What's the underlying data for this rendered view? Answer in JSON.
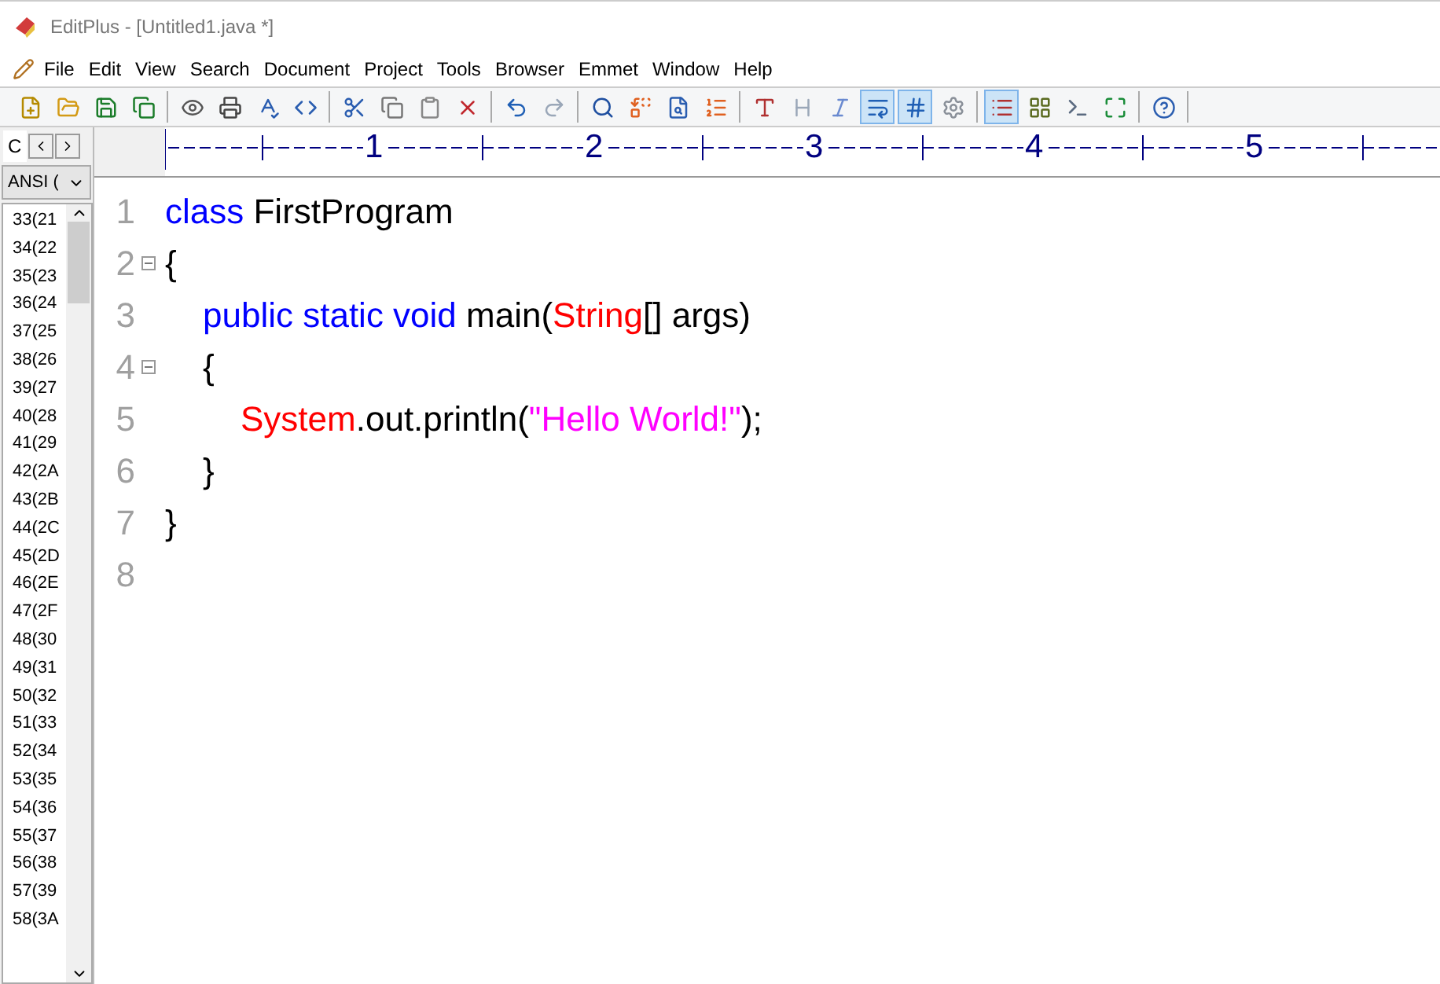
{
  "window": {
    "title": "EditPlus - [Untitled1.java *]"
  },
  "menu": [
    "File",
    "Edit",
    "View",
    "Search",
    "Document",
    "Project",
    "Tools",
    "Browser",
    "Emmet",
    "Window",
    "Help"
  ],
  "toolbar": [
    [
      {
        "kind": "new",
        "selected": false
      },
      {
        "kind": "open",
        "selected": false
      },
      {
        "kind": "save",
        "selected": false
      },
      {
        "kind": "save-all",
        "selected": false
      }
    ],
    [
      {
        "kind": "preview",
        "selected": false
      },
      {
        "kind": "print",
        "selected": false
      },
      {
        "kind": "spell",
        "selected": false
      },
      {
        "kind": "browser",
        "selected": false
      }
    ],
    [
      {
        "kind": "cut",
        "selected": false
      },
      {
        "kind": "copy",
        "selected": false
      },
      {
        "kind": "paste",
        "selected": false
      },
      {
        "kind": "delete",
        "selected": false
      }
    ],
    [
      {
        "kind": "undo",
        "selected": false
      },
      {
        "kind": "redo",
        "selected": false
      }
    ],
    [
      {
        "kind": "find",
        "selected": false
      },
      {
        "kind": "replace",
        "selected": false
      },
      {
        "kind": "find-files",
        "selected": false
      },
      {
        "kind": "goto",
        "selected": false
      }
    ],
    [
      {
        "kind": "font",
        "selected": false
      },
      {
        "kind": "hx",
        "selected": false
      },
      {
        "kind": "wrap-w",
        "selected": false
      },
      {
        "kind": "word-wrap",
        "selected": true
      },
      {
        "kind": "line-numbers",
        "selected": true
      },
      {
        "kind": "settings",
        "selected": false
      }
    ],
    [
      {
        "kind": "directory",
        "selected": true
      },
      {
        "kind": "cliptext",
        "selected": false
      },
      {
        "kind": "output",
        "selected": false
      },
      {
        "kind": "fullscreen",
        "selected": false
      }
    ],
    [
      {
        "kind": "help",
        "selected": false
      }
    ]
  ],
  "side_panel": {
    "tab": "C",
    "encoding": "ANSI (",
    "chars": [
      "33(21",
      "34(22",
      "35(23",
      "36(24",
      "37(25",
      "38(26",
      "39(27",
      "40(28",
      "41(29",
      "42(2A",
      "43(2B",
      "44(2C",
      "45(2D",
      "46(2E",
      "47(2F",
      "48(30",
      "49(31",
      "50(32",
      "51(33",
      "52(34",
      "53(35",
      "54(36",
      "55(37",
      "56(38",
      "57(39",
      "58(3A"
    ]
  },
  "ruler": [
    "1",
    "2",
    "3",
    "4",
    "5"
  ],
  "editor": {
    "lines": [
      {
        "number": "1",
        "fold": false,
        "tokens": [
          {
            "text": "class",
            "kind": "keyword"
          },
          {
            "text": " FirstProgram",
            "kind": "plain"
          }
        ]
      },
      {
        "number": "2",
        "fold": true,
        "tokens": [
          {
            "text": "{",
            "kind": "plain"
          }
        ],
        "children": [
          {
            "number": "3",
            "fold": false,
            "tokens": [
              {
                "text": "public static void",
                "kind": "keyword"
              },
              {
                "text": " main(",
                "kind": "plain"
              },
              {
                "text": "String",
                "kind": "type"
              },
              {
                "text": "[] args)",
                "kind": "plain"
              }
            ]
          },
          {
            "number": "4",
            "fold": true,
            "tokens": [
              {
                "text": "{",
                "kind": "plain"
              }
            ],
            "children": [
              {
                "number": "5",
                "fold": false,
                "tokens": [
                  {
                    "text": "System",
                    "kind": "type"
                  },
                  {
                    "text": ".out.println(",
                    "kind": "plain"
                  },
                  {
                    "text": "\"Hello World!\"",
                    "kind": "string"
                  },
                  {
                    "text": ");",
                    "kind": "plain"
                  }
                ]
              }
            ]
          },
          {
            "number": "6",
            "fold": false,
            "tokens": [
              {
                "text": "}",
                "kind": "plain"
              }
            ]
          }
        ]
      },
      {
        "number": "7",
        "fold": false,
        "tokens": [
          {
            "text": "}",
            "kind": "plain"
          }
        ]
      },
      {
        "number": "8",
        "fold": false
      }
    ]
  }
}
